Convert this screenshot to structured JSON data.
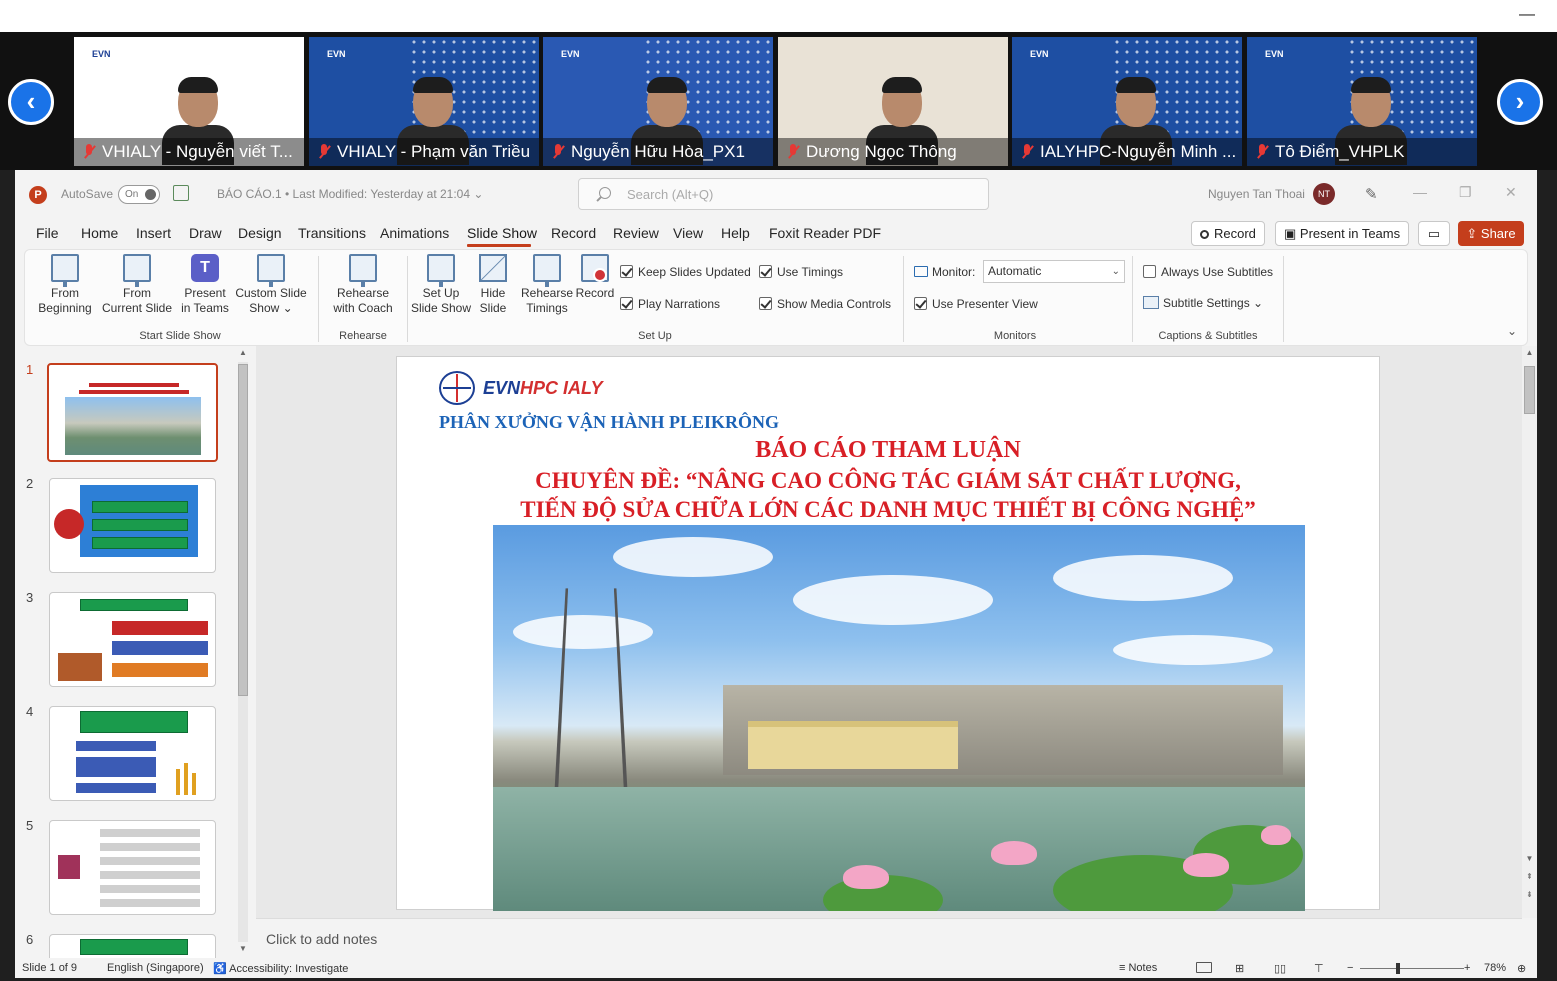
{
  "gallery": {
    "participants": [
      {
        "name": "VHIALY - Nguyễn viết T...",
        "bg": "#ffffff",
        "logo_color": "#1c3f94"
      },
      {
        "name": "VHIALY - Phạm văn Triều",
        "bg": "#1e4fa3",
        "logo_color": "#ffffff"
      },
      {
        "name": "Nguyễn Hữu Hòa_PX1",
        "bg": "#2a59b3",
        "logo_color": "#ffffff"
      },
      {
        "name": "Dương Ngọc Thông",
        "bg": "#e9e2d6",
        "logo_color": "#ffffff"
      },
      {
        "name": "IALYHPC-Nguyễn Minh ...",
        "bg": "#1e4fa3",
        "logo_color": "#ffffff"
      },
      {
        "name": "Tô Điểm_VHPLK",
        "bg": "#1e4fa3",
        "logo_color": "#ffffff"
      }
    ],
    "logo_text": "EVN"
  },
  "titlebar": {
    "autosave_label": "AutoSave",
    "autosave_state": "On",
    "doc_title": "BÁO CÁO.1 • Last Modified: Yesterday at 21:04  ⌄",
    "search_placeholder": "Search (Alt+Q)",
    "user_name": "Nguyen Tan Thoai",
    "user_initials": "NT"
  },
  "menu": {
    "items": [
      "File",
      "Home",
      "Insert",
      "Draw",
      "Design",
      "Transitions",
      "Animations",
      "Slide Show",
      "Record",
      "Review",
      "View",
      "Help",
      "Foxit Reader PDF"
    ],
    "active": "Slide Show",
    "record_btn": "Record",
    "present_btn": "Present in Teams",
    "share_btn": "Share"
  },
  "ribbon": {
    "start": {
      "from_beginning": [
        "From",
        "Beginning"
      ],
      "from_current": [
        "From",
        "Current Slide"
      ],
      "present_teams": [
        "Present",
        "in Teams"
      ],
      "custom_show": [
        "Custom Slide",
        "Show ⌄"
      ],
      "group_label": "Start Slide Show"
    },
    "rehearse": {
      "btn": [
        "Rehearse",
        "with Coach"
      ],
      "group_label": "Rehearse"
    },
    "setup": {
      "setup_show": [
        "Set Up",
        "Slide Show"
      ],
      "hide_slide": [
        "Hide",
        "Slide"
      ],
      "rehearse_timings": [
        "Rehearse",
        "Timings"
      ],
      "record": "Record",
      "keep_updated": "Keep Slides Updated",
      "play_narrations": "Play Narrations",
      "use_timings": "Use Timings",
      "show_media": "Show Media Controls",
      "group_label": "Set Up"
    },
    "monitors": {
      "monitor_label": "Monitor:",
      "monitor_value": "Automatic",
      "presenter_view": "Use Presenter View",
      "group_label": "Monitors"
    },
    "captions": {
      "always_subtitles": "Always Use Subtitles",
      "subtitle_settings": "Subtitle Settings ⌄",
      "group_label": "Captions & Subtitles"
    }
  },
  "thumbnails": [
    "1",
    "2",
    "3",
    "4",
    "5",
    "6"
  ],
  "slide": {
    "brand_a": "EVN",
    "brand_b": "HPC IALY",
    "subtitle": "PHÂN XƯỞNG VẬN HÀNH PLEIKRÔNG",
    "title_1": "BÁO CÁO THAM LUẬN",
    "title_2": "CHUYÊN ĐỀ: “NÂNG CAO CÔNG TÁC GIÁM SÁT CHẤT LƯỢNG,",
    "title_3": "TIẾN ĐỘ SỬA CHỮA LỚN CÁC DANH MỤC THIẾT BỊ CÔNG NGHỆ”"
  },
  "notes_placeholder": "Click to add notes",
  "status": {
    "slide_count": "Slide 1 of 9",
    "language": "English (Singapore)",
    "accessibility": "Accessibility: Investigate",
    "notes_btn": "Notes",
    "zoom_minus": "−",
    "zoom_plus": "+",
    "zoom_level": "78%"
  },
  "colors": {
    "accent": "#c43e1c",
    "title_red": "#d81f26",
    "subtitle_blue": "#1c63b7"
  }
}
